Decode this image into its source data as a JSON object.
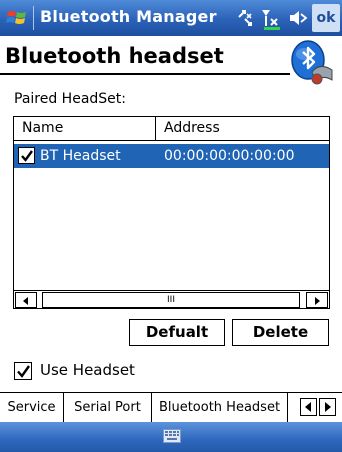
{
  "titlebar": {
    "title": "Bluetooth Manager",
    "ok_label": "ok",
    "icons": [
      "windows-start-icon",
      "connectivity-icon",
      "signal-icon",
      "volume-icon"
    ]
  },
  "header": {
    "title": "Bluetooth headset",
    "icon": "bluetooth-headset-icon"
  },
  "paired": {
    "label": "Paired HeadSet:",
    "columns": [
      "Name",
      "Address"
    ],
    "rows": [
      {
        "checked": true,
        "name": "BT Headset",
        "address": "00:00:00:00:00:00"
      }
    ],
    "scroll_thumb_glyph": "III"
  },
  "buttons": {
    "default_label": "Defualt",
    "delete_label": "Delete"
  },
  "use_headset": {
    "label": "Use Headset",
    "checked": true
  },
  "tabs": [
    {
      "label": "Service"
    },
    {
      "label": "Serial Port"
    },
    {
      "label": "Bluetooth Headset",
      "active": true
    }
  ],
  "colors": {
    "titlebar": "#2b62b8",
    "selection": "#1f64b5",
    "bottombar": "#2f67be"
  },
  "bottombar": {
    "icon": "keyboard-icon"
  }
}
